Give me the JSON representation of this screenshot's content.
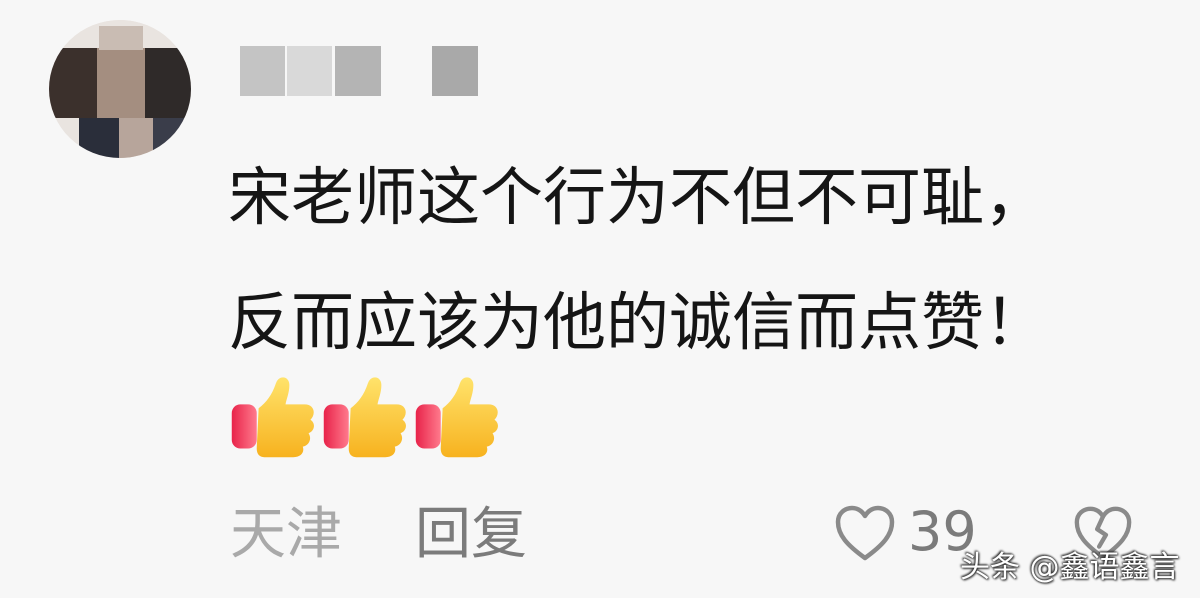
{
  "comment": {
    "author": {
      "avatar_icon": "blurred-avatar",
      "username_icon": "pixelated-username"
    },
    "text_lines": [
      "宋老师这个行为不但不可耻，",
      "反而应该为他的诚信而点赞！"
    ],
    "emojis": [
      "thumbs-up",
      "thumbs-up",
      "thumbs-up"
    ],
    "location": "天津",
    "reply_label": "回复",
    "like_icon": "heart-outline-icon",
    "like_count": "39",
    "dislike_icon": "broken-heart-icon"
  },
  "watermark": "头条 @鑫语鑫言"
}
